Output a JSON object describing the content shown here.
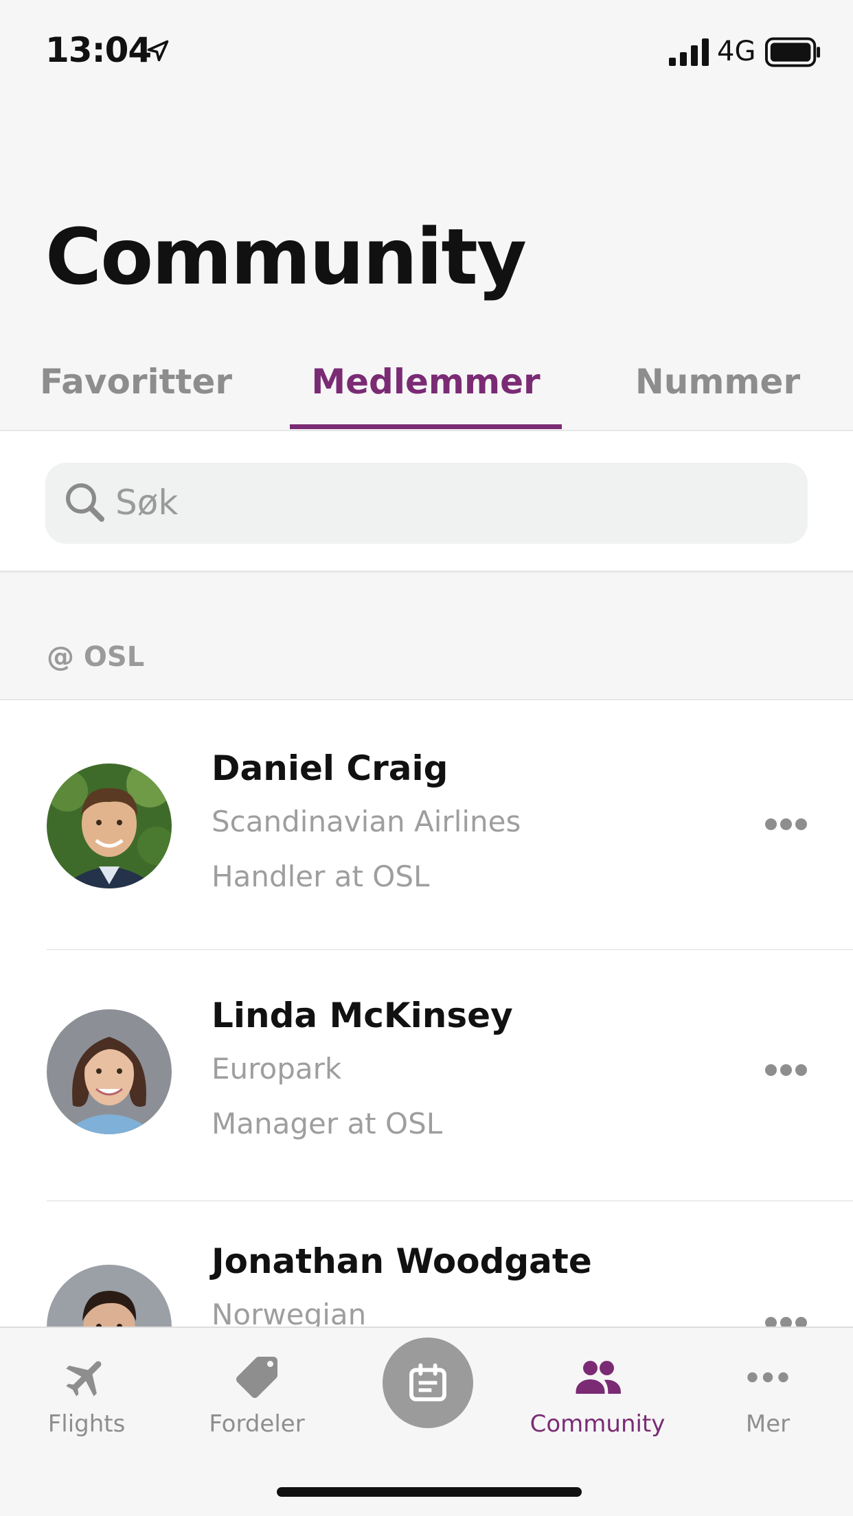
{
  "status_bar": {
    "time": "13:04",
    "network": "4G",
    "icons": [
      "location-arrow-icon",
      "signal-icon",
      "battery-icon"
    ]
  },
  "page": {
    "title": "Community"
  },
  "tabs": [
    {
      "label": "Favoritter",
      "active": false
    },
    {
      "label": "Medlemmer",
      "active": true
    },
    {
      "label": "Nummer",
      "active": false
    }
  ],
  "search": {
    "placeholder": "Søk",
    "value": ""
  },
  "section": {
    "label": "@ OSL"
  },
  "members": [
    {
      "name": "Daniel Craig",
      "company": "Scandinavian Airlines",
      "role": "Handler at OSL"
    },
    {
      "name": "Linda McKinsey",
      "company": "Europark",
      "role": "Manager at OSL"
    },
    {
      "name": "Jonathan Woodgate",
      "company": "Norwegian",
      "role": ""
    }
  ],
  "bottom_nav": {
    "items": [
      {
        "label": "Flights",
        "icon": "airplane-icon",
        "active": false
      },
      {
        "label": "Fordeler",
        "icon": "tag-icon",
        "active": false
      },
      {
        "label": "Community",
        "icon": "people-icon",
        "active": true
      },
      {
        "label": "Mer",
        "icon": "ellipsis-icon",
        "active": false
      }
    ],
    "center_icon": "calendar-icon"
  },
  "colors": {
    "accent": "#7a2b74",
    "inactive": "#8e8e8e",
    "background": "#f6f6f6"
  }
}
